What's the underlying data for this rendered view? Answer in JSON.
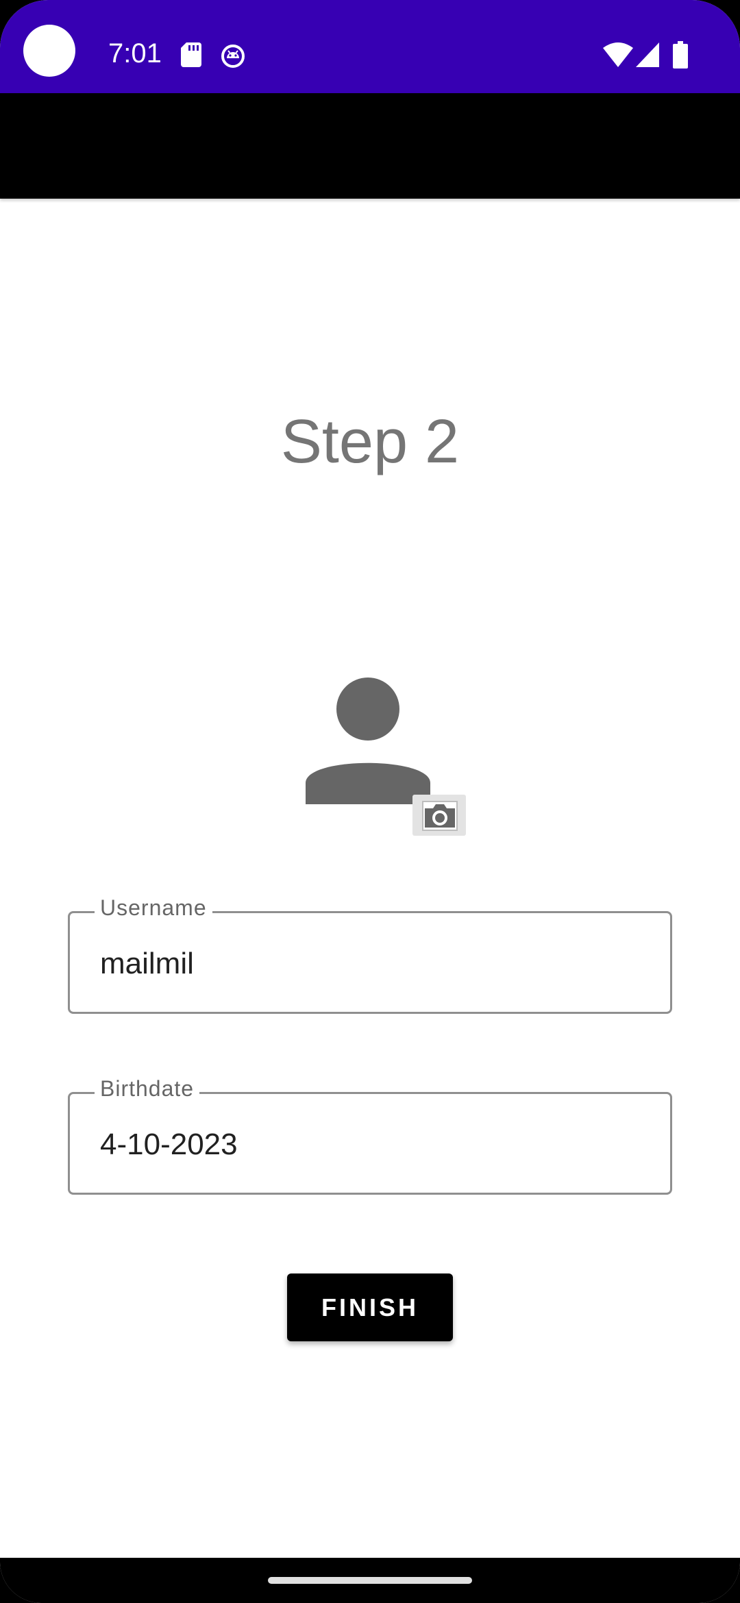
{
  "status_bar": {
    "time": "7:01",
    "background_color": "#3700b3",
    "left_icons": [
      "sd-card-icon",
      "android-debug-icon"
    ],
    "right_icons": [
      "wifi-icon",
      "signal-icon",
      "battery-icon"
    ]
  },
  "app_bar": {
    "background_color": "#000000"
  },
  "main": {
    "title": "Step 2",
    "avatar_icon": "person-icon",
    "camera_icon": "camera-icon",
    "fields": {
      "username": {
        "label": "Username",
        "value": "mailmil"
      },
      "birthdate": {
        "label": "Birthdate",
        "value": "4-10-2023"
      }
    },
    "finish_label": "FINISH"
  },
  "nav_bar": {
    "home_indicator": "home-indicator"
  }
}
